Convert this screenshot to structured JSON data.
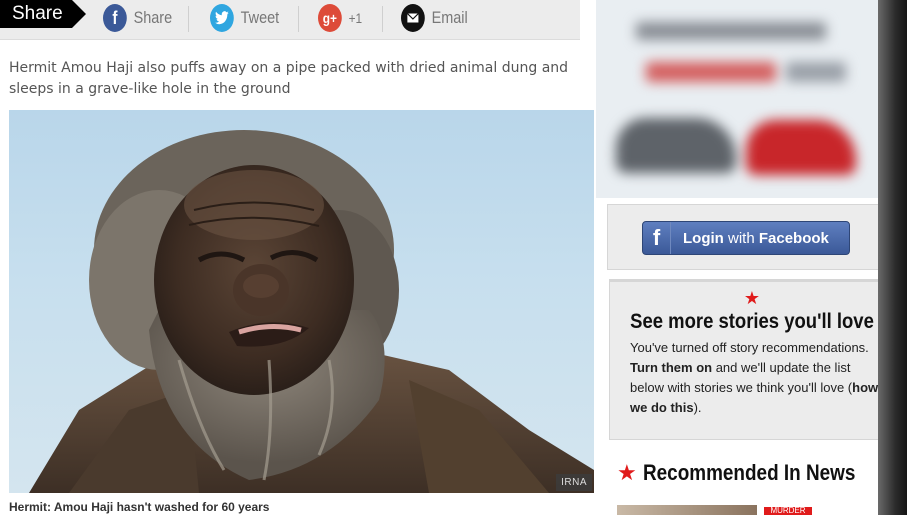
{
  "sharebar": {
    "tag_label": "Share",
    "facebook_label": "Share",
    "twitter_label": "Tweet",
    "google_label": "+1",
    "email_label": "Email",
    "colors": {
      "facebook": "#3b5998",
      "twitter": "#2fa6e0",
      "google": "#dd4b39",
      "email": "#111111"
    }
  },
  "article": {
    "intro_caption": "Hermit Amou Haji also puffs away on a pipe packed with dried animal dung and sleeps in a grave-like hole in the ground",
    "photo_credit": "IRNA",
    "photo_caption": "Hermit: Amou Haji hasn't washed for 60 years"
  },
  "sidebar": {
    "facebook_login": {
      "prefix": "Login",
      "middle": " with ",
      "suffix": "Facebook"
    },
    "more_stories": {
      "title": "See more stories you'll love",
      "line1": "You've turned off story recommendations.",
      "turn_on_link": "Turn them on",
      "line2": " and we'll update the list below with stories we think you'll love (",
      "how_link": "how we do this",
      "line3": ")."
    },
    "recommended_title": "Recommended In News",
    "rec_tag": "MURDER"
  },
  "colors": {
    "accent_red": "#e01b1b",
    "facebook_blue": "#3b5998"
  }
}
